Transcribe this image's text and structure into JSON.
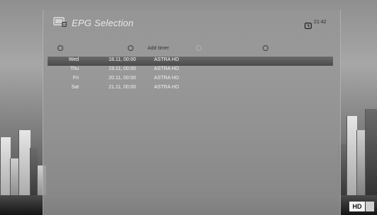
{
  "header": {
    "title": "EPG Selection",
    "clock": "21:42",
    "title_icon": "epg-icon",
    "clock_icon": "clock-icon"
  },
  "buttons": {
    "red_label": "",
    "green_label": "Add timer",
    "yellow_label": "",
    "blue_label": ""
  },
  "list": [
    {
      "day": "Wed",
      "date": "18.11, 00:00",
      "channel": "ASTRA HD",
      "selected": true
    },
    {
      "day": "Thu",
      "date": "19.11, 00:00",
      "channel": "ASTRA HD",
      "selected": false
    },
    {
      "day": "Fri",
      "date": "20.11, 00:00",
      "channel": "ASTRA HD",
      "selected": false
    },
    {
      "day": "Sat",
      "date": "21.11, 00:00",
      "channel": "ASTRA HD",
      "selected": false
    }
  ],
  "badge": {
    "text": "HD"
  },
  "colors": {
    "panel": "#969696",
    "selected_row": "#555555",
    "text": "#f2f2f2"
  }
}
